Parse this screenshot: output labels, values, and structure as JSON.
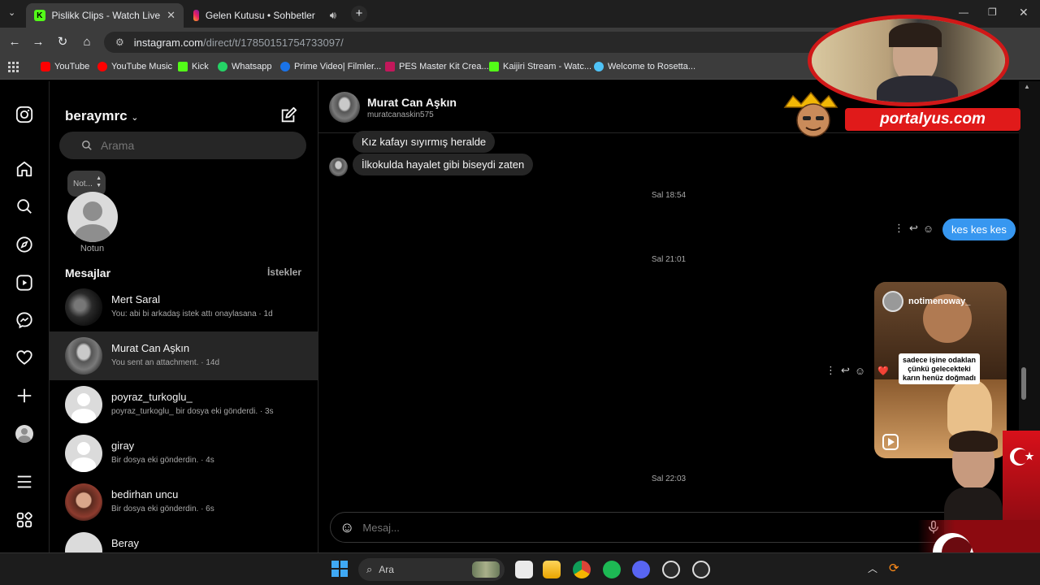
{
  "browser": {
    "tabs": [
      {
        "title": "Pislikk Clips - Watch Live on Kic",
        "favicon": "kick-icon",
        "active": true
      },
      {
        "title": "Gelen Kutusu • Sohbetler",
        "favicon": "instagram-icon",
        "active": false
      }
    ],
    "url_host": "instagram.com",
    "url_path": "/direct/t/17850151754733097/",
    "bookmarks": [
      "YouTube",
      "YouTube Music",
      "Kick",
      "Whatsapp",
      "Prime Video| Filmler...",
      "PES Master Kit Crea...",
      "Kaijiri Stream - Watc...",
      "Welcome to Rosetta..."
    ]
  },
  "sidebar": {
    "username": "beraymrc",
    "search_placeholder": "Arama",
    "note_bubble": "Not...",
    "note_label": "Notun",
    "messages_heading": "Mesajlar",
    "requests_label": "İstekler",
    "conversations": [
      {
        "name": "Mert Saral",
        "preview": "You: abi bi arkadaş istek attı onaylasana · 1d"
      },
      {
        "name": "Murat Can Aşkın",
        "preview": "You sent an attachment. · 14d"
      },
      {
        "name": "poyraz_turkoglu_",
        "preview": "poyraz_turkoglu_ bir dosya eki gönderdi. · 3s"
      },
      {
        "name": "giray",
        "preview": "Bir dosya eki gönderdin. · 4s"
      },
      {
        "name": "bedirhan uncu",
        "preview": "Bir dosya eki gönderdin. · 6s"
      },
      {
        "name": "Beray",
        "preview": ""
      }
    ]
  },
  "chat": {
    "name": "Murat Can Aşkın",
    "handle": "muratcanaskin575",
    "messages_in": [
      "Kız kafayı sıyırmış heralde",
      "İlkokulda hayalet gibi biseydi zaten"
    ],
    "time_1": "Sal 18:54",
    "message_out": "kes kes kes",
    "time_2": "Sal 21:01",
    "reel_user": "notimenoway_",
    "reel_caption": "sadece işine odaklan çünkü gelecekteki karın henüz doğmadı",
    "reel_reaction": "❤️",
    "time_3": "Sal 22:03",
    "composer_placeholder": "Mesaj..."
  },
  "overlay": {
    "brand": "portalyus.com"
  },
  "taskbar": {
    "search_label": "Ara"
  }
}
